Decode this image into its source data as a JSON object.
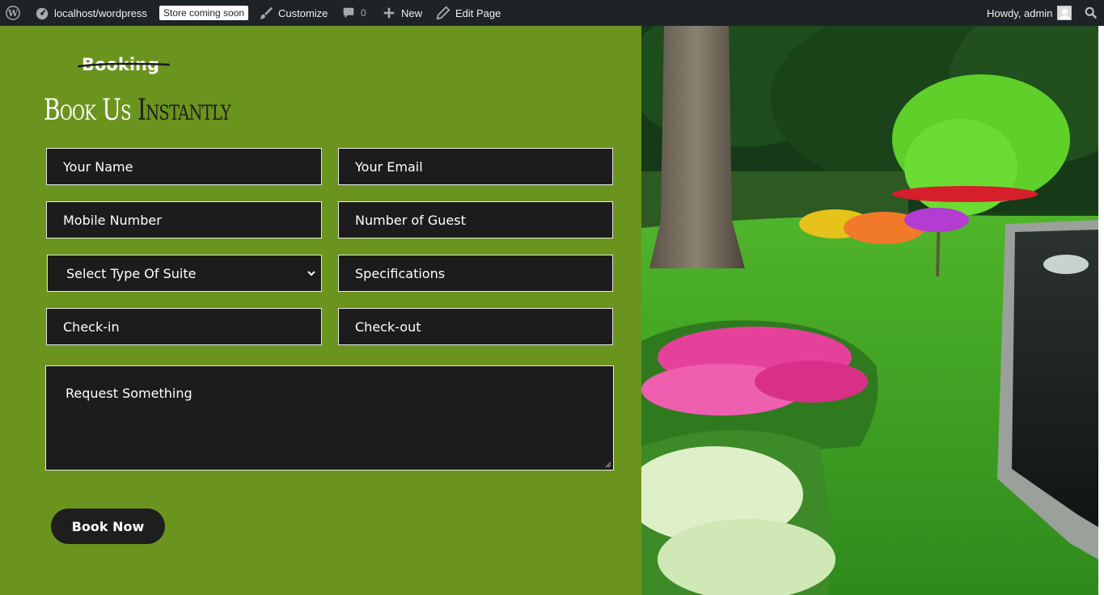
{
  "adminbar": {
    "wp_logo_icon": "wordpress-icon",
    "site_name": "localhost/wordpress",
    "store_badge": "Store coming soon",
    "customize": "Customize",
    "comments_count": "0",
    "new": "New",
    "edit_page": "Edit Page",
    "howdy": "Howdy, admin"
  },
  "booking": {
    "eyebrow": "Booking",
    "heading_part1": "Book Us ",
    "heading_part2": "Instantly",
    "fields": {
      "name": "Your Name",
      "email": "Your Email",
      "mobile": "Mobile Number",
      "guests": "Number of Guest",
      "suite_select": "Select Type Of Suite",
      "specifications": "Specifications",
      "checkin": "Check-in",
      "checkout": "Check-out",
      "request": "Request Something"
    },
    "button": "Book Now"
  },
  "colors": {
    "panel_green": "#6b941e",
    "field_bg": "#1c1c1c",
    "adminbar_bg": "#1d2327"
  }
}
